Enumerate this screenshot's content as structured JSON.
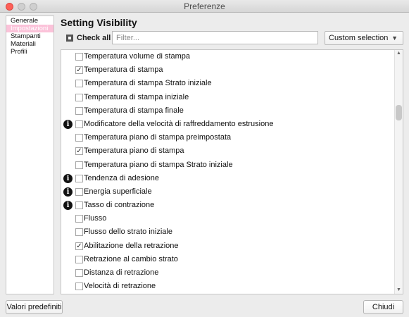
{
  "window": {
    "title": "Preferenze"
  },
  "sidebar": {
    "items": [
      {
        "label": "Generale",
        "selected": false
      },
      {
        "label": "Impostazioni",
        "selected": true
      },
      {
        "label": "Stampanti",
        "selected": false
      },
      {
        "label": "Materiali",
        "selected": false
      },
      {
        "label": "Profili",
        "selected": false
      }
    ]
  },
  "main": {
    "title": "Setting Visibility",
    "check_all_label": "Check all",
    "filter_placeholder": "Filter...",
    "filter_value": "",
    "visibility_select": "Custom selection"
  },
  "settings": [
    {
      "label": "Temperatura volume di stampa",
      "checked": false,
      "info": false
    },
    {
      "label": "Temperatura di stampa",
      "checked": true,
      "info": false
    },
    {
      "label": "Temperatura di stampa Strato iniziale",
      "checked": false,
      "info": false
    },
    {
      "label": "Temperatura di stampa iniziale",
      "checked": false,
      "info": false
    },
    {
      "label": "Temperatura di stampa finale",
      "checked": false,
      "info": false
    },
    {
      "label": "Modificatore della velocità di raffreddamento estrusione",
      "checked": false,
      "info": true
    },
    {
      "label": "Temperatura piano di stampa preimpostata",
      "checked": false,
      "info": false
    },
    {
      "label": "Temperatura piano di stampa",
      "checked": true,
      "info": false
    },
    {
      "label": "Temperatura piano di stampa Strato iniziale",
      "checked": false,
      "info": false
    },
    {
      "label": "Tendenza di adesione",
      "checked": false,
      "info": true
    },
    {
      "label": "Energia superficiale",
      "checked": false,
      "info": true
    },
    {
      "label": "Tasso di contrazione",
      "checked": false,
      "info": true
    },
    {
      "label": "Flusso",
      "checked": false,
      "info": false
    },
    {
      "label": "Flusso dello strato iniziale",
      "checked": false,
      "info": false
    },
    {
      "label": "Abilitazione della retrazione",
      "checked": true,
      "info": false
    },
    {
      "label": "Retrazione al cambio strato",
      "checked": false,
      "info": false
    },
    {
      "label": "Distanza di retrazione",
      "checked": false,
      "info": false
    },
    {
      "label": "Velocità di retrazione",
      "checked": false,
      "info": false
    }
  ],
  "footer": {
    "defaults_label": "Valori predefiniti",
    "close_label": "Chiudi"
  },
  "icons": {
    "info": "info-icon",
    "checkmark": "checkmark-icon",
    "dropdown": "chevron-down-icon"
  },
  "colors": {
    "selected_item_bg": "#fbc2d9",
    "close_button": "#fd5f57"
  }
}
